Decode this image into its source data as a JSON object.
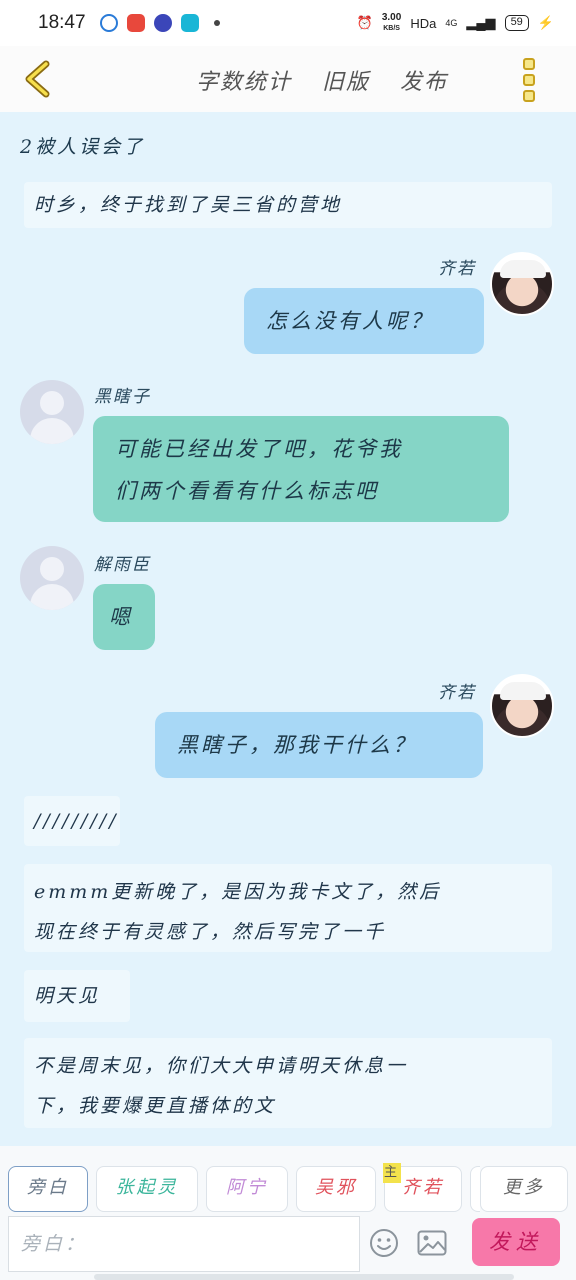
{
  "status_bar": {
    "time": "18:47",
    "speed": "3.00",
    "speed_unit": "KB/S",
    "hd": "HDa",
    "network": "4G",
    "battery": "59"
  },
  "header": {
    "actions": [
      "字数统计",
      "旧版",
      "发布"
    ]
  },
  "messages": {
    "intro": "2被人误会了",
    "m1": "时乡，终于找到了吴三省的营地",
    "m2_name": "齐若",
    "m2_text": "怎么没有人呢？",
    "m3_name": "黑瞎子",
    "m3_line1": "可能已经出发了吧，花爷我",
    "m3_line2": "们两个看看有什么标志吧",
    "m4_name": "解雨臣",
    "m4_text": "嗯",
    "m5_name": "齐若",
    "m5_text": "黑瞎子，那我干什么？",
    "n1": "/////////",
    "n2_line1": "emmm更新晚了，是因为我卡文了，然后",
    "n2_line2": "现在终于有灵感了，然后写完了一千",
    "n3": "明天见",
    "n4_line1": "不是周末见，你们大大申请明天休息一",
    "n4_line2": "下，我要爆更直播体的文"
  },
  "role_bar": {
    "items": [
      "旁白",
      "张起灵",
      "阿宁",
      "吴邪",
      "齐若",
      "更多"
    ],
    "badge": "主"
  },
  "input": {
    "placeholder": "旁白：",
    "send_label": "发送"
  },
  "colors": {
    "background": "#e3f3fc",
    "bubble_right": "#a8d8f6",
    "bubble_left": "#85d5c6",
    "send": "#f778a9"
  }
}
